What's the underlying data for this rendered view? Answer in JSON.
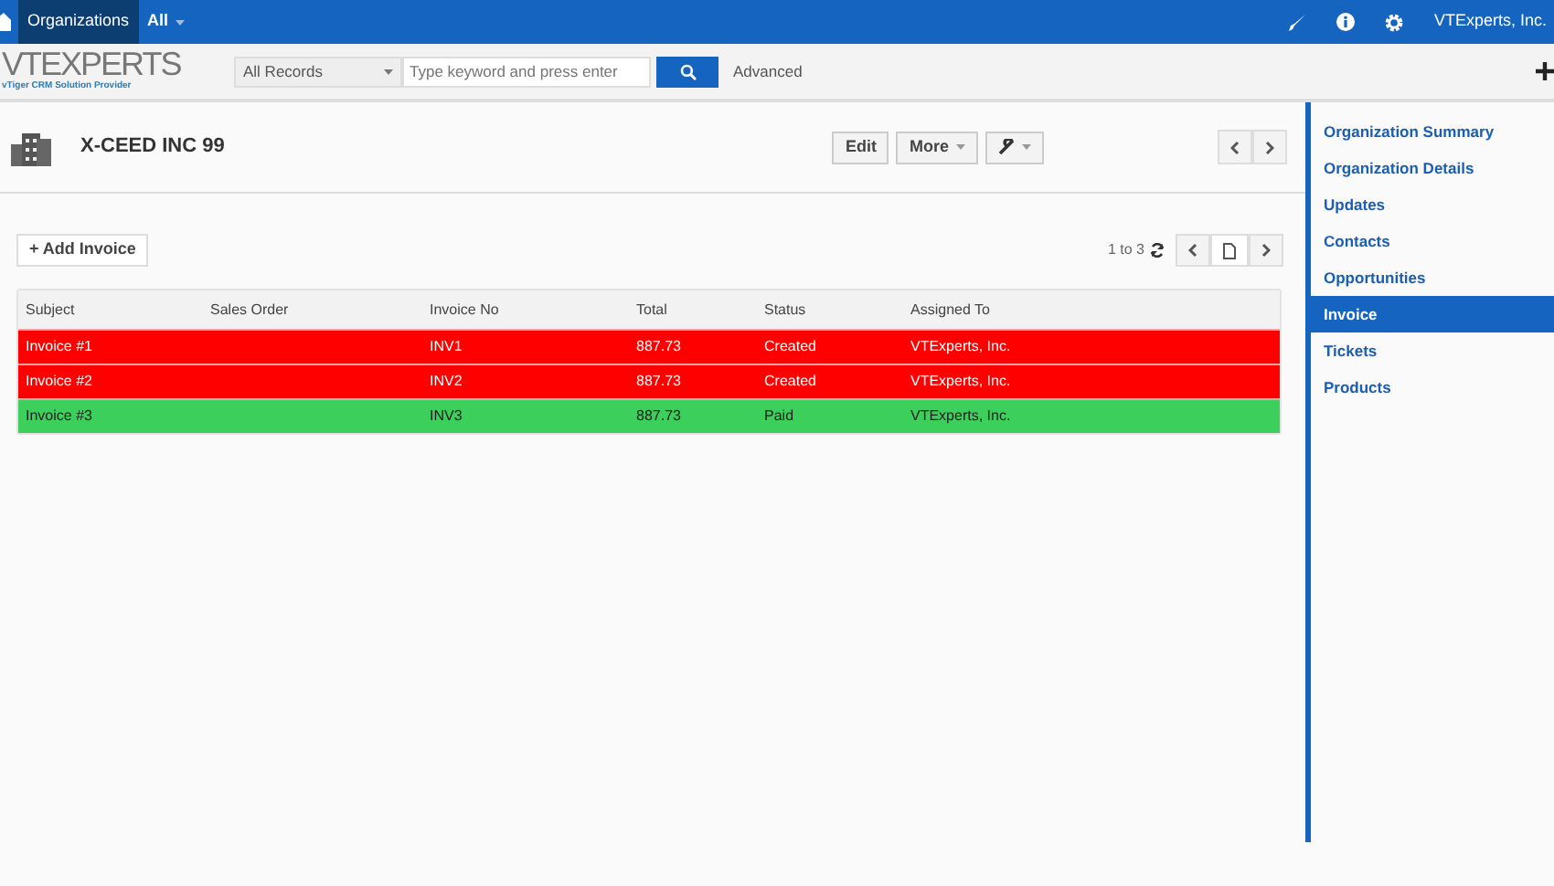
{
  "top_nav": {
    "tabs": [
      {
        "label": "Organizations",
        "selected": true
      },
      {
        "label": "All",
        "selected": false
      }
    ],
    "user": "VTExperts, Inc."
  },
  "search_bar": {
    "logo": "VTEXPERTS",
    "logo_tagline": "vTiger CRM Solution Provider",
    "filter": "All Records",
    "placeholder": "Type keyword and press enter",
    "advanced": "Advanced"
  },
  "record": {
    "title": "X-CEED INC 99",
    "buttons": [
      "Edit",
      "More"
    ]
  },
  "related": {
    "add_button": "+ Add Invoice",
    "range": "1 to 3",
    "columns": [
      "Subject",
      "Sales Order",
      "Invoice No",
      "Total",
      "Status",
      "Assigned To"
    ],
    "rows": [
      {
        "cells": [
          "Invoice #1",
          "",
          "INV1",
          "887.73",
          "Created",
          "VTExperts, Inc."
        ],
        "color": "#ff0000"
      },
      {
        "cells": [
          "Invoice #2",
          "",
          "INV2",
          "887.73",
          "Created",
          "VTExperts, Inc."
        ],
        "color": "#ff0000"
      },
      {
        "cells": [
          "Invoice #3",
          "",
          "INV3",
          "887.73",
          "Paid",
          "VTExperts, Inc."
        ],
        "color": "#3ccf5b"
      }
    ]
  },
  "sidebar": {
    "items": [
      {
        "label": "Organization Summary",
        "selected": false
      },
      {
        "label": "Organization Details",
        "selected": false
      },
      {
        "label": "Updates",
        "selected": false
      },
      {
        "label": "Contacts",
        "selected": false
      },
      {
        "label": "Opportunities",
        "selected": false
      },
      {
        "label": "Invoice",
        "selected": true
      },
      {
        "label": "Tickets",
        "selected": false
      },
      {
        "label": "Products",
        "selected": false
      }
    ]
  }
}
